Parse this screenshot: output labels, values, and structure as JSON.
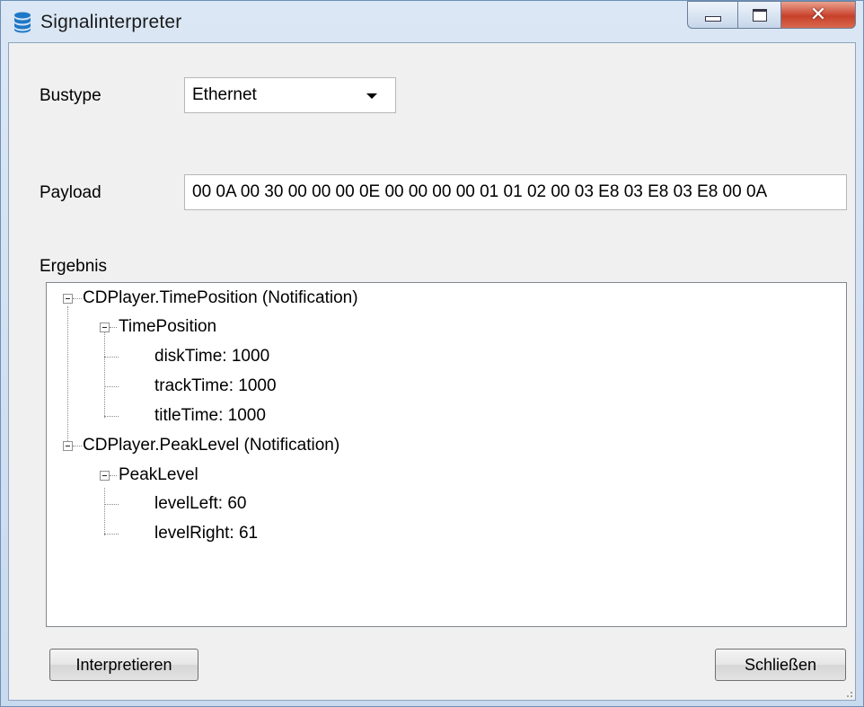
{
  "window": {
    "title": "Signalinterpreter",
    "icon": "database-icon"
  },
  "form": {
    "bustype_label": "Bustype",
    "bustype_value": "Ethernet",
    "payload_label": "Payload",
    "payload_value": "00 0A 00 30 00 00 00 0E 00 00 00 00 01 01 02 00 03 E8 03 E8 03 E8 00 0A",
    "result_label": "Ergebnis"
  },
  "tree": {
    "n1": "CDPlayer.TimePosition (Notification)",
    "n1_1": "TimePosition",
    "n1_1_1": "diskTime: 1000",
    "n1_1_2": "trackTime: 1000",
    "n1_1_3": "titleTime: 1000",
    "n2": "CDPlayer.PeakLevel (Notification)",
    "n2_1": "PeakLevel",
    "n2_1_1": "levelLeft: 60",
    "n2_1_2": "levelRight: 61"
  },
  "buttons": {
    "interpret": "Interpretieren",
    "close": "Schließen"
  },
  "colors": {
    "window_frame": "#c9daee",
    "client_bg": "#f0f0f0",
    "close_button": "#c8402a"
  }
}
